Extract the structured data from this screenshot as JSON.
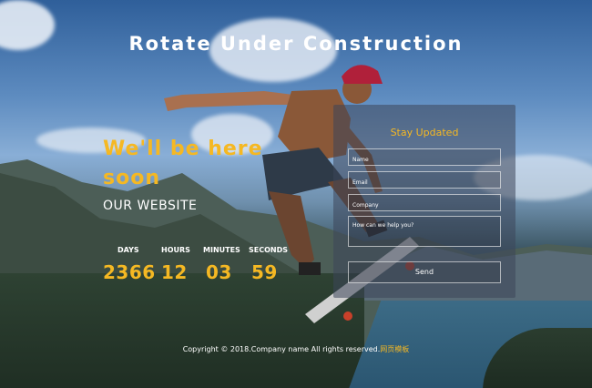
{
  "header": {
    "title": "Rotate Under Construction"
  },
  "hero": {
    "headline": "We'll be here soon",
    "subtitle": "OUR WEBSITE"
  },
  "countdown": [
    {
      "label": "DAYS",
      "value": "2366"
    },
    {
      "label": "HOURS",
      "value": "12"
    },
    {
      "label": "MINUTES",
      "value": "03"
    },
    {
      "label": "SECONDS",
      "value": "59"
    }
  ],
  "form": {
    "title": "Stay Updated",
    "name_placeholder": "Name",
    "email_placeholder": "Email",
    "company_placeholder": "Company",
    "message_placeholder": "How can we help you?",
    "send_label": "Send"
  },
  "footer": {
    "text": "Copyright © 2018.Company name All rights reserved.",
    "link": "网页模板"
  },
  "colors": {
    "accent": "#f5b823",
    "panel": "rgba(60,70,90,0.55)"
  }
}
